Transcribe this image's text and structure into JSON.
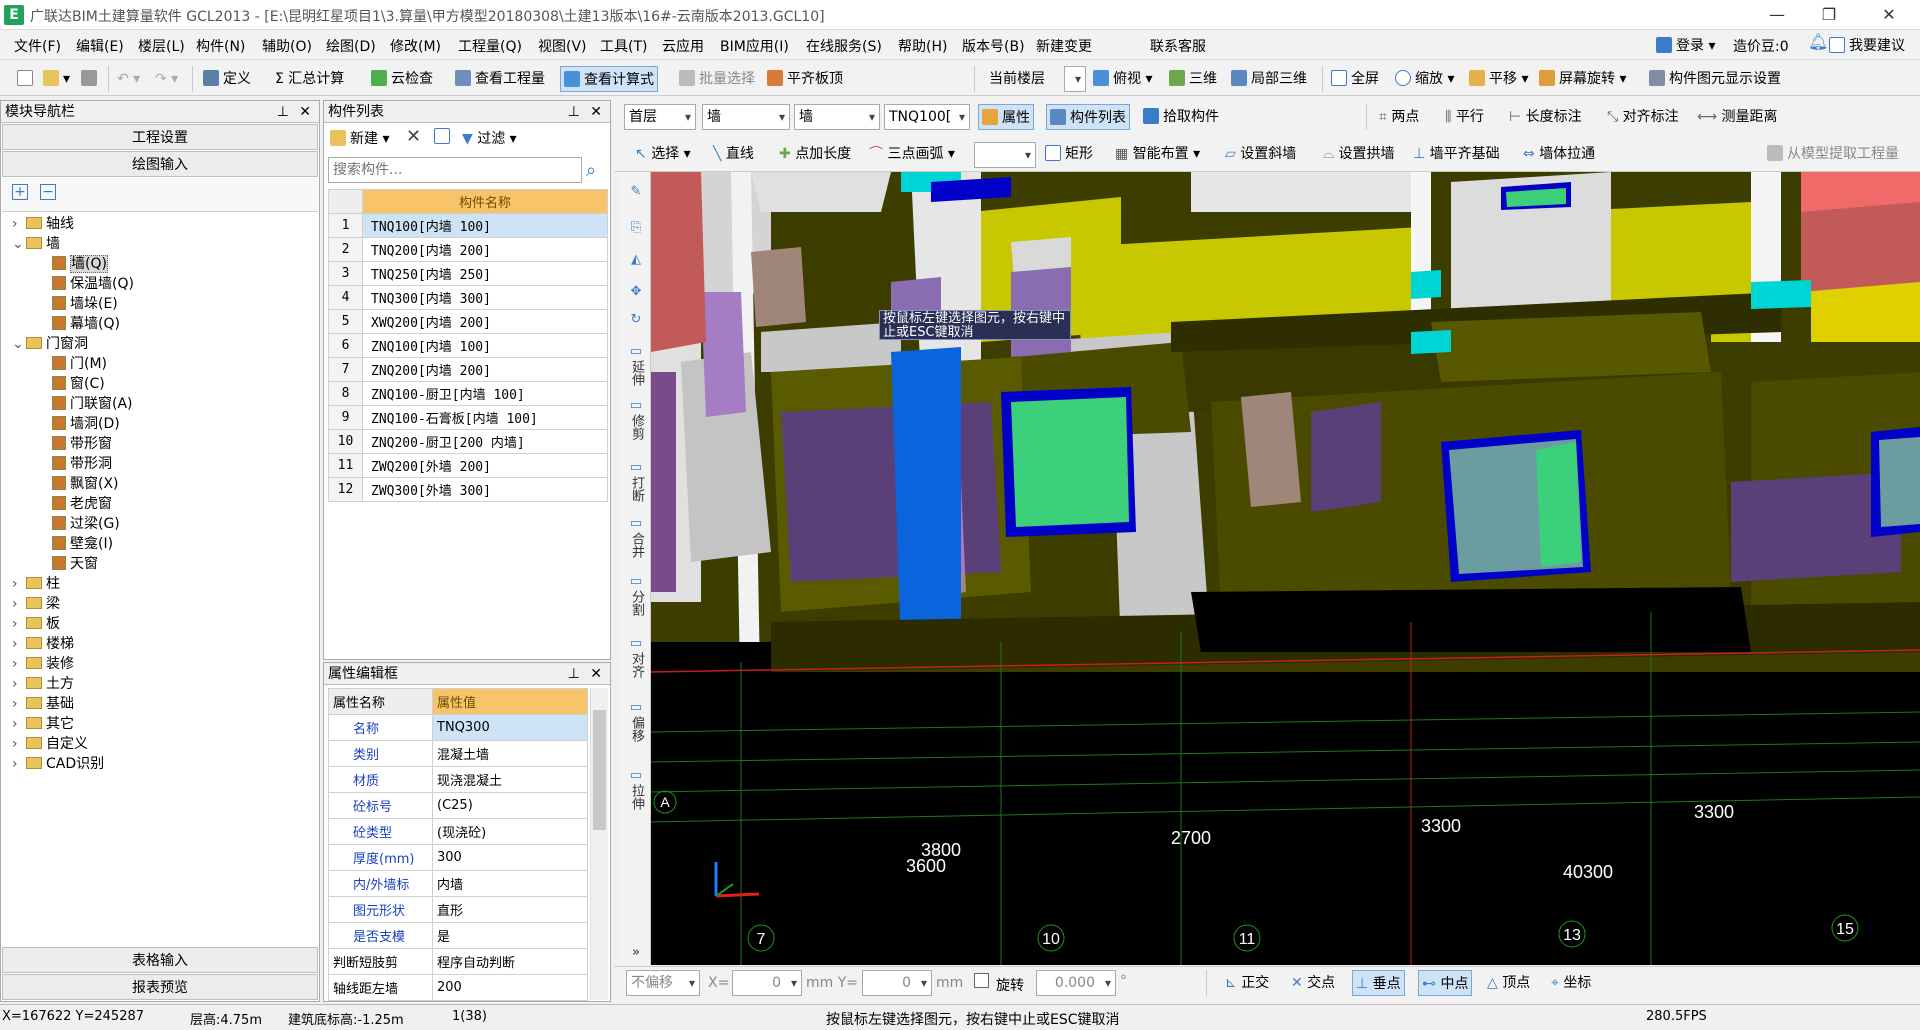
{
  "window": {
    "title": "广联达BIM土建算量软件 GCL2013 - [E:\\昆明红星项目1\\3.算量\\甲方模型20180308\\土建13版本\\16#-云南版本2013.GCL10]",
    "logo": "E"
  },
  "menu": [
    "文件(F)",
    "编辑(E)",
    "楼层(L)",
    "构件(N)",
    "辅助(O)",
    "绘图(D)",
    "修改(M)",
    "工程量(Q)",
    "视图(V)",
    "工具(T)",
    "云应用",
    "BIM应用(I)",
    "在线服务(S)",
    "帮助(H)",
    "版本号(B)",
    "新建变更",
    "联系客服"
  ],
  "menu_right": {
    "login": "登录",
    "coins": "造价豆:0",
    "suggest": "我要建议"
  },
  "toolbar1": {
    "define": "定义",
    "calc": "汇总计算",
    "cloud_check": "云检查",
    "view_qty": "查看工程量",
    "view_formula": "查看计算式",
    "batch_select": "批量选择",
    "align_slab": "平齐板顶",
    "current_floor": "当前楼层",
    "top_view": "俯视",
    "three_d": "三维",
    "local_3d": "局部三维",
    "fullscreen": "全屏",
    "zoom": "缩放",
    "pan": "平移",
    "rotate": "屏幕旋转",
    "display_settings": "构件图元显示设置"
  },
  "toolbar2": {
    "floor": "首层",
    "type1": "墙",
    "type2": "墙",
    "component": "TNQ100[",
    "props": "属性",
    "comp_list": "构件列表",
    "pick": "拾取构件",
    "two_points": "两点",
    "parallel": "平行",
    "length_dim": "长度标注",
    "align_dim": "对齐标注",
    "measure": "测量距离"
  },
  "toolbar3": {
    "select": "选择",
    "line": "直线",
    "point_len": "点加长度",
    "arc": "三点画弧",
    "rect": "矩形",
    "smart": "智能布置",
    "slope": "设置斜墙",
    "arch": "设置拱墙",
    "align_base": "墙平齐基础",
    "stretch": "墙体拉通",
    "extract": "从模型提取工程量"
  },
  "module_nav": {
    "title": "模块导航栏",
    "project_settings": "工程设置",
    "draw_input": "绘图输入",
    "tree": [
      {
        "label": "轴线",
        "level": 0,
        "type": "folder",
        "expanded": false
      },
      {
        "label": "墙",
        "level": 0,
        "type": "folder",
        "expanded": true
      },
      {
        "label": "墙(Q)",
        "level": 1,
        "type": "leaf",
        "selected": true
      },
      {
        "label": "保温墙(Q)",
        "level": 1,
        "type": "leaf"
      },
      {
        "label": "墙垛(E)",
        "level": 1,
        "type": "leaf"
      },
      {
        "label": "幕墙(Q)",
        "level": 1,
        "type": "leaf"
      },
      {
        "label": "门窗洞",
        "level": 0,
        "type": "folder",
        "expanded": true
      },
      {
        "label": "门(M)",
        "level": 1,
        "type": "leaf"
      },
      {
        "label": "窗(C)",
        "level": 1,
        "type": "leaf"
      },
      {
        "label": "门联窗(A)",
        "level": 1,
        "type": "leaf"
      },
      {
        "label": "墙洞(D)",
        "level": 1,
        "type": "leaf"
      },
      {
        "label": "带形窗",
        "level": 1,
        "type": "leaf"
      },
      {
        "label": "带形洞",
        "level": 1,
        "type": "leaf"
      },
      {
        "label": "飘窗(X)",
        "level": 1,
        "type": "leaf"
      },
      {
        "label": "老虎窗",
        "level": 1,
        "type": "leaf"
      },
      {
        "label": "过梁(G)",
        "level": 1,
        "type": "leaf"
      },
      {
        "label": "壁龛(I)",
        "level": 1,
        "type": "leaf"
      },
      {
        "label": "天窗",
        "level": 1,
        "type": "leaf"
      },
      {
        "label": "柱",
        "level": 0,
        "type": "folder",
        "expanded": false
      },
      {
        "label": "梁",
        "level": 0,
        "type": "folder",
        "expanded": false
      },
      {
        "label": "板",
        "level": 0,
        "type": "folder",
        "expanded": false
      },
      {
        "label": "楼梯",
        "level": 0,
        "type": "folder",
        "expanded": false
      },
      {
        "label": "装修",
        "level": 0,
        "type": "folder",
        "expanded": false
      },
      {
        "label": "土方",
        "level": 0,
        "type": "folder",
        "expanded": false
      },
      {
        "label": "基础",
        "level": 0,
        "type": "folder",
        "expanded": false
      },
      {
        "label": "其它",
        "level": 0,
        "type": "folder",
        "expanded": false
      },
      {
        "label": "自定义",
        "level": 0,
        "type": "folder",
        "expanded": false
      },
      {
        "label": "CAD识别",
        "level": 0,
        "type": "folder",
        "expanded": false
      }
    ],
    "table_input": "表格输入",
    "report_preview": "报表预览"
  },
  "comp_list": {
    "title": "构件列表",
    "new": "新建",
    "filter": "过滤",
    "search_placeholder": "搜索构件...",
    "column": "构件名称",
    "rows": [
      "TNQ100[内墙 100]",
      "TNQ200[内墙 200]",
      "TNQ250[内墙 250]",
      "TNQ300[内墙 300]",
      "XWQ200[内墙 200]",
      "ZNQ100[内墙 100]",
      "ZNQ200[内墙 200]",
      "ZNQ100-厨卫[内墙 100]",
      "ZNQ100-石膏板[内墙 100]",
      "ZNQ200-厨卫[200 内墙]",
      "ZWQ200[外墙 200]",
      "ZWQ300[外墙 300]"
    ],
    "selected_index": 0
  },
  "prop_editor": {
    "title": "属性编辑框",
    "col_name": "属性名称",
    "col_value": "属性值",
    "rows": [
      {
        "name": "名称",
        "value": "TNQ300"
      },
      {
        "name": "类别",
        "value": "混凝土墙"
      },
      {
        "name": "材质",
        "value": "现浇混凝土"
      },
      {
        "name": "砼标号",
        "value": "(C25)"
      },
      {
        "name": "砼类型",
        "value": "(现浇砼)"
      },
      {
        "name": "厚度(mm)",
        "value": "300"
      },
      {
        "name": "内/外墙标",
        "value": "内墙"
      },
      {
        "name": "图元形状",
        "value": "直形"
      },
      {
        "name": "是否支模",
        "value": "是"
      },
      {
        "name": "判断短肢剪",
        "value": "程序自动判断"
      },
      {
        "name": "轴线距左墙",
        "value": "200"
      }
    ]
  },
  "vertical_tools": [
    "延伸",
    "修剪",
    "打断",
    "合并",
    "分割",
    "对齐",
    "偏移",
    "拉伸"
  ],
  "viewport": {
    "tooltip": "按鼠标左键选择图元，按右键中止或ESC键取消",
    "axis_labels": [
      "A",
      "7",
      "10",
      "11",
      "13",
      "15"
    ],
    "dims": [
      "3800",
      "3600",
      "2700",
      "3300",
      "3300",
      "40300"
    ]
  },
  "bottom_bar": {
    "offset_mode": "不偏移",
    "x_label": "X=",
    "x_val": "0",
    "y_label": "mm Y=",
    "y_val": "0",
    "unit": "mm",
    "rotate": "旋转",
    "angle": "0.000",
    "deg": "°",
    "ortho": "正交",
    "intersect": "交点",
    "perp": "垂点",
    "mid": "中点",
    "vertex": "顶点",
    "coord": "坐标"
  },
  "status": {
    "coords": "X=167622 Y=245287",
    "floor_height": "层高:4.75m",
    "base_elev": "建筑底标高:-1.25m",
    "count": "1(38)",
    "message": "按鼠标左键选择图元，按右键中止或ESC键取消",
    "fps": "280.5FPS"
  }
}
